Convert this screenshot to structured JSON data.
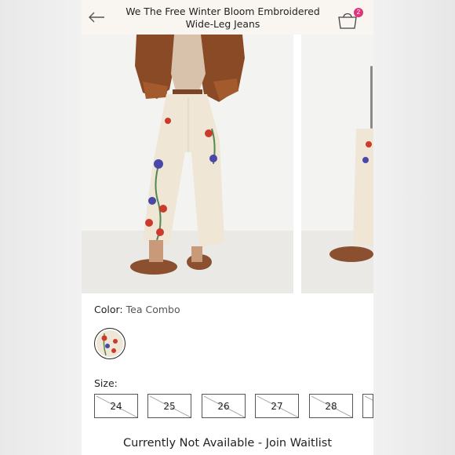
{
  "header": {
    "title_line1": "We The Free Winter Bloom Embroidered",
    "title_line2": "Wide-Leg Jeans",
    "cart_count": "2",
    "back_icon": "arrow-left-icon",
    "cart_icon": "shopping-bag-icon"
  },
  "product": {
    "color_label": "Color:",
    "color_value": "Tea Combo",
    "size_label": "Size:",
    "sizes": [
      "24",
      "25",
      "26",
      "27",
      "28"
    ],
    "sizes_available": false,
    "waitlist_text": "Currently Not Available - Join Waitlist"
  },
  "colors": {
    "badge": "#e0357a",
    "header_bg": "#f9f6f2",
    "jeans": "#efe6d6"
  }
}
